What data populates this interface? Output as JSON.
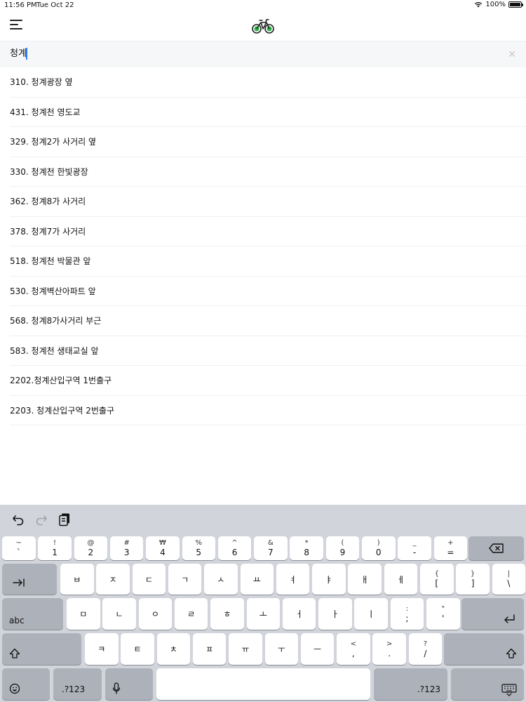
{
  "status": {
    "time": "11:56 PM",
    "date": "Tue Oct 22",
    "battery": "100%"
  },
  "search": {
    "value": "청계"
  },
  "results": [
    "310. 청계광장 옆",
    "431. 청계천 영도교",
    "329. 청계2가 사거리 옆",
    "330. 청계천 한빛광장",
    "362. 청계8가 사거리",
    "378. 청계7가 사거리",
    "518. 청계천 박물관 앞",
    "530. 청계벽산아파트 앞",
    "568. 청계8가사거리 부근",
    "583. 청계천 생태교실 앞",
    "2202.청계산입구역 1번출구",
    "2203. 청계산입구역 2번출구"
  ],
  "icons": {
    "menu": "hamburger-icon",
    "logo": "bicycle-icon",
    "clear": "close-icon",
    "undo": "undo-icon",
    "redo": "redo-icon",
    "paste": "clipboard-icon",
    "delete": "backspace-icon",
    "tab": "tab-icon",
    "return": "return-icon",
    "shift": "shift-icon",
    "emoji": "emoji-icon",
    "mic": "microphone-icon",
    "hide": "keyboard-hide-icon"
  },
  "colors": {
    "caret": "#2a7fff",
    "logo_green": "#2eb24a",
    "keyboard_bg": "#d1d4da"
  },
  "keyboard": {
    "row1": [
      {
        "top": "~",
        "bot": "`"
      },
      {
        "top": "!",
        "bot": "1"
      },
      {
        "top": "@",
        "bot": "2"
      },
      {
        "top": "#",
        "bot": "3"
      },
      {
        "top": "₩",
        "bot": "4"
      },
      {
        "top": "%",
        "bot": "5"
      },
      {
        "top": "^",
        "bot": "6"
      },
      {
        "top": "&",
        "bot": "7"
      },
      {
        "top": "*",
        "bot": "8"
      },
      {
        "top": "(",
        "bot": "9"
      },
      {
        "top": ")",
        "bot": "0"
      },
      {
        "top": "_",
        "bot": "-"
      },
      {
        "top": "+",
        "bot": "="
      }
    ],
    "row2": [
      {
        "single": "ㅂ"
      },
      {
        "single": "ㅈ"
      },
      {
        "single": "ㄷ"
      },
      {
        "single": "ㄱ"
      },
      {
        "single": "ㅅ"
      },
      {
        "single": "ㅛ"
      },
      {
        "single": "ㅕ"
      },
      {
        "single": "ㅑ"
      },
      {
        "single": "ㅐ"
      },
      {
        "single": "ㅔ"
      },
      {
        "top": "{",
        "bot": "["
      },
      {
        "top": "}",
        "bot": "]"
      },
      {
        "top": "|",
        "bot": "\\"
      }
    ],
    "row3": [
      {
        "single": "ㅁ"
      },
      {
        "single": "ㄴ"
      },
      {
        "single": "ㅇ"
      },
      {
        "single": "ㄹ"
      },
      {
        "single": "ㅎ"
      },
      {
        "single": "ㅗ"
      },
      {
        "single": "ㅓ"
      },
      {
        "single": "ㅏ"
      },
      {
        "single": "ㅣ"
      },
      {
        "top": ":",
        "bot": ";"
      },
      {
        "top": "\"",
        "bot": "'"
      }
    ],
    "row4": [
      {
        "single": "ㅋ"
      },
      {
        "single": "ㅌ"
      },
      {
        "single": "ㅊ"
      },
      {
        "single": "ㅍ"
      },
      {
        "single": "ㅠ"
      },
      {
        "single": "ㅜ"
      },
      {
        "single": "ㅡ"
      },
      {
        "top": "<",
        "bot": ","
      },
      {
        "top": ">",
        "bot": "."
      },
      {
        "top": "?",
        "bot": "/"
      }
    ],
    "capslock_label": "abc",
    "numbers_label": ".?123"
  }
}
